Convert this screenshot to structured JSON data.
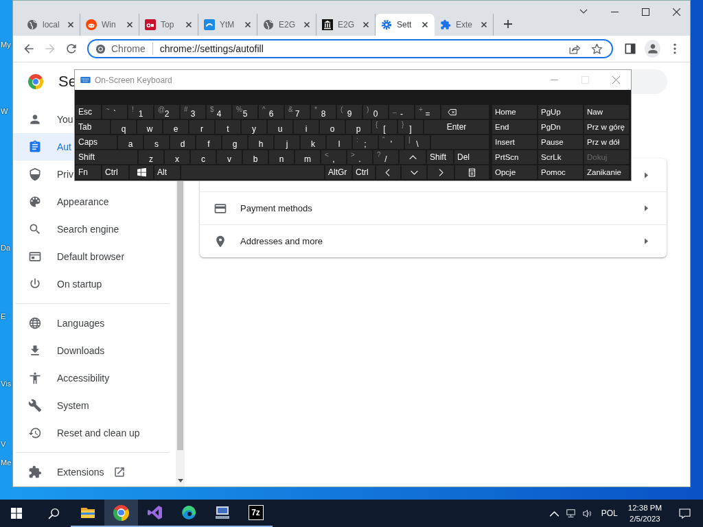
{
  "desktop": {
    "icon_labels": [
      "My",
      "W",
      "Da",
      "E",
      "Vis",
      "V",
      "Me"
    ]
  },
  "browser": {
    "tabs": [
      {
        "title": "local",
        "selected": false
      },
      {
        "title": "Win",
        "selected": false
      },
      {
        "title": "Top",
        "selected": false
      },
      {
        "title": "YtM",
        "selected": false
      },
      {
        "title": "E2G",
        "selected": false
      },
      {
        "title": "E2G",
        "selected": false
      },
      {
        "title": "Sett",
        "selected": true
      },
      {
        "title": "Exte",
        "selected": false
      }
    ],
    "forward_enabled": false,
    "address_bar": {
      "chip": "Chrome",
      "url": "chrome://settings/autofill"
    }
  },
  "settings": {
    "title": "Se",
    "sidebar_groups": [
      [
        {
          "label": "You",
          "selected": false
        },
        {
          "label": "Aut",
          "selected": true
        },
        {
          "label": "Priv",
          "selected": false
        },
        {
          "label": "Appearance",
          "selected": false
        },
        {
          "label": "Search engine",
          "selected": false
        },
        {
          "label": "Default browser",
          "selected": false
        },
        {
          "label": "On startup",
          "selected": false
        }
      ],
      [
        {
          "label": "Languages",
          "selected": false
        },
        {
          "label": "Downloads",
          "selected": false
        },
        {
          "label": "Accessibility",
          "selected": false
        },
        {
          "label": "System",
          "selected": false
        },
        {
          "label": "Reset and clean up",
          "selected": false
        }
      ]
    ],
    "footer_link": {
      "label": "Extensions"
    },
    "autofill_rows": [
      {
        "label": "Payment methods"
      },
      {
        "label": "Addresses and more"
      }
    ]
  },
  "osk": {
    "title": "On-Screen Keyboard",
    "rows": [
      [
        {
          "kind": "mod",
          "label": "Esc"
        },
        {
          "kind": "char",
          "label": "`",
          "shift": "~"
        },
        {
          "kind": "char",
          "label": "1",
          "shift": "!"
        },
        {
          "kind": "char",
          "label": "2",
          "shift": "@"
        },
        {
          "kind": "char",
          "label": "3",
          "shift": "#"
        },
        {
          "kind": "char",
          "label": "4",
          "shift": "$"
        },
        {
          "kind": "char",
          "label": "5",
          "shift": "%"
        },
        {
          "kind": "char",
          "label": "6",
          "shift": "^"
        },
        {
          "kind": "char",
          "label": "7",
          "shift": "&"
        },
        {
          "kind": "char",
          "label": "8",
          "shift": "*"
        },
        {
          "kind": "char",
          "label": "9",
          "shift": "("
        },
        {
          "kind": "char",
          "label": "0",
          "shift": ")"
        },
        {
          "kind": "char",
          "label": "-",
          "shift": "_"
        },
        {
          "kind": "char",
          "label": "=",
          "shift": "+"
        },
        {
          "kind": "backspace"
        }
      ],
      [
        {
          "kind": "mod",
          "label": "Tab"
        },
        {
          "kind": "char",
          "label": "q"
        },
        {
          "kind": "char",
          "label": "w"
        },
        {
          "kind": "char",
          "label": "e"
        },
        {
          "kind": "char",
          "label": "r"
        },
        {
          "kind": "char",
          "label": "t"
        },
        {
          "kind": "char",
          "label": "y"
        },
        {
          "kind": "char",
          "label": "u"
        },
        {
          "kind": "char",
          "label": "i"
        },
        {
          "kind": "char",
          "label": "o"
        },
        {
          "kind": "char",
          "label": "p"
        },
        {
          "kind": "char",
          "label": "[",
          "shift": "{"
        },
        {
          "kind": "char",
          "label": "]",
          "shift": "}"
        },
        {
          "kind": "enter",
          "label": "Enter"
        }
      ],
      [
        {
          "kind": "mod",
          "label": "Caps"
        },
        {
          "kind": "char",
          "label": "a"
        },
        {
          "kind": "char",
          "label": "s"
        },
        {
          "kind": "char",
          "label": "d"
        },
        {
          "kind": "char",
          "label": "f"
        },
        {
          "kind": "char",
          "label": "g"
        },
        {
          "kind": "char",
          "label": "h"
        },
        {
          "kind": "char",
          "label": "j"
        },
        {
          "kind": "char",
          "label": "k"
        },
        {
          "kind": "char",
          "label": "l"
        },
        {
          "kind": "char",
          "label": ";",
          "shift": ":"
        },
        {
          "kind": "char",
          "label": "'",
          "shift": "\""
        },
        {
          "kind": "char",
          "label": "\\",
          "shift": "|"
        },
        {
          "kind": "gap"
        }
      ],
      [
        {
          "kind": "mod",
          "label": "Shift"
        },
        {
          "kind": "char",
          "label": "z"
        },
        {
          "kind": "char",
          "label": "x"
        },
        {
          "kind": "char",
          "label": "c"
        },
        {
          "kind": "char",
          "label": "v"
        },
        {
          "kind": "char",
          "label": "b"
        },
        {
          "kind": "char",
          "label": "n"
        },
        {
          "kind": "char",
          "label": "m"
        },
        {
          "kind": "char",
          "label": ",",
          "shift": "<"
        },
        {
          "kind": "char",
          "label": ".",
          "shift": ">"
        },
        {
          "kind": "char",
          "label": "/",
          "shift": "?"
        },
        {
          "kind": "up"
        },
        {
          "kind": "mod",
          "label": "Shift"
        },
        {
          "kind": "mod",
          "label": "Del"
        }
      ],
      [
        {
          "kind": "mod",
          "label": "Fn"
        },
        {
          "kind": "mod",
          "label": "Ctrl"
        },
        {
          "kind": "windows"
        },
        {
          "kind": "mod",
          "label": "Alt"
        },
        {
          "kind": "space"
        },
        {
          "kind": "mod",
          "label": "AltGr"
        },
        {
          "kind": "mod",
          "label": "Ctrl"
        },
        {
          "kind": "left"
        },
        {
          "kind": "down"
        },
        {
          "kind": "right"
        },
        {
          "kind": "menu"
        }
      ]
    ],
    "nav_rows": [
      [
        {
          "label": "Home",
          "disabled": false
        },
        {
          "label": "PgUp",
          "disabled": false
        },
        {
          "label": "Naw",
          "disabled": false
        }
      ],
      [
        {
          "label": "End",
          "disabled": false
        },
        {
          "label": "PgDn",
          "disabled": false
        },
        {
          "label": "Prz w górę",
          "disabled": false
        }
      ],
      [
        {
          "label": "Insert",
          "disabled": false
        },
        {
          "label": "Pause",
          "disabled": false
        },
        {
          "label": "Prz w dół",
          "disabled": false
        }
      ],
      [
        {
          "label": "PrtScn",
          "disabled": false
        },
        {
          "label": "ScrLk",
          "disabled": false
        },
        {
          "label": "Dokuj",
          "disabled": true
        }
      ],
      [
        {
          "label": "Opcje",
          "disabled": false
        },
        {
          "label": "Pomoc",
          "disabled": false
        },
        {
          "label": "Zanikanie",
          "disabled": false
        }
      ]
    ]
  },
  "taskbar": {
    "apps": [
      {
        "running": true,
        "selected": false
      },
      {
        "running": true,
        "selected": true
      },
      {
        "running": true,
        "selected": false
      },
      {
        "running": true,
        "selected": false
      },
      {
        "running": true,
        "selected": false
      },
      {
        "running": true,
        "selected": false,
        "logo_text": "7z"
      }
    ],
    "language": "POL",
    "time": "12:38 PM",
    "date": "2/5/2023"
  }
}
